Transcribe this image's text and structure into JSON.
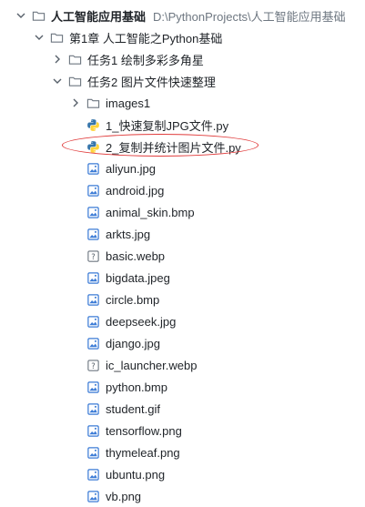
{
  "tree": {
    "root": {
      "label": "人工智能应用基础",
      "path": "D:\\PythonProjects\\人工智能应用基础",
      "icon": "folder-icon"
    },
    "chapter": {
      "label": "第1章 人工智能之Python基础",
      "icon": "folder-icon"
    },
    "task1": {
      "label": "任务1 绘制多彩多角星",
      "icon": "folder-icon"
    },
    "task2": {
      "label": "任务2 图片文件快速整理",
      "icon": "folder-icon"
    },
    "images_folder": {
      "label": "images1",
      "icon": "folder-icon"
    },
    "files": [
      {
        "label": "1_快速复制JPG文件.py",
        "icon": "python-file-icon"
      },
      {
        "label": "2_复制并统计图片文件.py",
        "icon": "python-file-icon"
      },
      {
        "label": "aliyun.jpg",
        "icon": "image-file-icon"
      },
      {
        "label": "android.jpg",
        "icon": "image-file-icon"
      },
      {
        "label": "animal_skin.bmp",
        "icon": "image-file-icon"
      },
      {
        "label": "arkts.jpg",
        "icon": "image-file-icon"
      },
      {
        "label": "basic.webp",
        "icon": "unknown-file-icon"
      },
      {
        "label": "bigdata.jpeg",
        "icon": "image-file-icon"
      },
      {
        "label": "circle.bmp",
        "icon": "image-file-icon"
      },
      {
        "label": "deepseek.jpg",
        "icon": "image-file-icon"
      },
      {
        "label": "django.jpg",
        "icon": "image-file-icon"
      },
      {
        "label": "ic_launcher.webp",
        "icon": "unknown-file-icon"
      },
      {
        "label": "python.bmp",
        "icon": "image-file-icon"
      },
      {
        "label": "student.gif",
        "icon": "image-file-icon"
      },
      {
        "label": "tensorflow.png",
        "icon": "image-file-icon"
      },
      {
        "label": "thymeleaf.png",
        "icon": "image-file-icon"
      },
      {
        "label": "ubuntu.png",
        "icon": "image-file-icon"
      },
      {
        "label": "vb.png",
        "icon": "image-file-icon"
      }
    ]
  },
  "colors": {
    "annotation_ellipse": "#e03b3b",
    "path_text": "#6e7781"
  }
}
